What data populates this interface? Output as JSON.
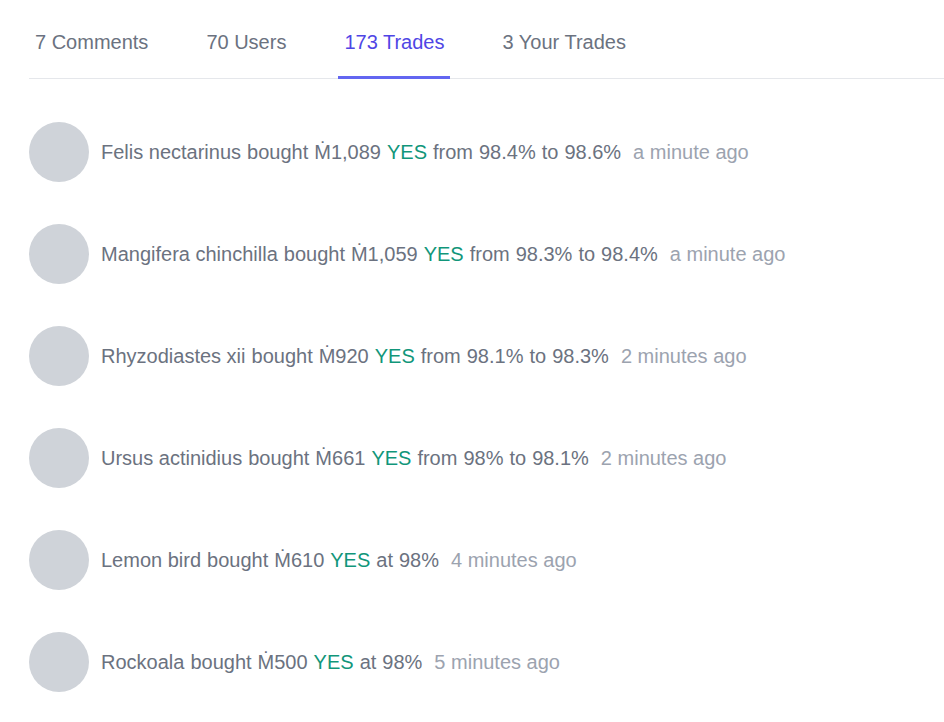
{
  "tabs": [
    {
      "label": "7 Comments",
      "selected": false
    },
    {
      "label": "70 Users",
      "selected": false
    },
    {
      "label": "173 Trades",
      "selected": true
    },
    {
      "label": "3 Your Trades",
      "selected": false
    }
  ],
  "trades": [
    {
      "user": "Felis nectarinus",
      "verb": "bought",
      "amount": "Ṁ1,089",
      "outcome": "YES",
      "price_parts": [
        "from",
        "98.4%",
        "to",
        "98.6%"
      ],
      "time": "a minute ago"
    },
    {
      "user": "Mangifera chinchilla",
      "verb": "bought",
      "amount": "Ṁ1,059",
      "outcome": "YES",
      "price_parts": [
        "from",
        "98.3%",
        "to",
        "98.4%"
      ],
      "time": "a minute ago"
    },
    {
      "user": "Rhyzodiastes xii",
      "verb": "bought",
      "amount": "Ṁ920",
      "outcome": "YES",
      "price_parts": [
        "from",
        "98.1%",
        "to",
        "98.3%"
      ],
      "time": "2 minutes ago"
    },
    {
      "user": "Ursus actinidius",
      "verb": "bought",
      "amount": "Ṁ661",
      "outcome": "YES",
      "price_parts": [
        "from",
        "98%",
        "to",
        "98.1%"
      ],
      "time": "2 minutes ago"
    },
    {
      "user": "Lemon bird",
      "verb": "bought",
      "amount": "Ṁ610",
      "outcome": "YES",
      "price_parts": [
        "at",
        "98%"
      ],
      "time": "4 minutes ago"
    },
    {
      "user": "Rockoala",
      "verb": "bought",
      "amount": "Ṁ500",
      "outcome": "YES",
      "price_parts": [
        "at",
        "98%"
      ],
      "time": "5 minutes ago"
    }
  ]
}
